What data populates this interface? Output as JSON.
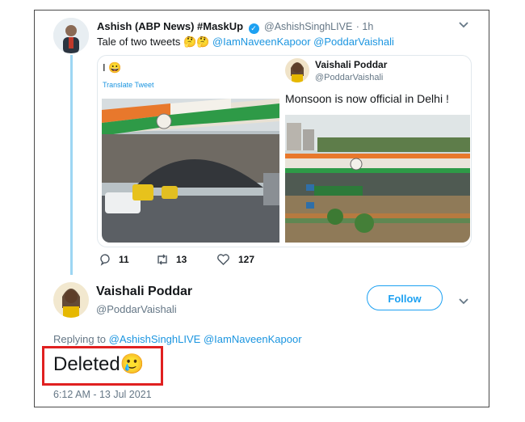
{
  "original_tweet": {
    "display_name": "Ashish (ABP News) #MaskUp",
    "handle": "@AshishSinghLIVE",
    "time": "· 1h",
    "text_prefix": "Tale of two tweets 🤔🤔",
    "mention_1": "@IamNaveenKapoor",
    "mention_2": "@PoddarVaishali",
    "left_embed": {
      "text": "I 😀",
      "translate_label": "Translate Tweet"
    },
    "right_embed": {
      "display_name": "Vaishali Poddar",
      "handle": "@PoddarVaishali",
      "text": "Monsoon is now official in Delhi !"
    },
    "actions": {
      "replies": "11",
      "retweets": "13",
      "likes": "127"
    }
  },
  "reply_tweet": {
    "display_name": "Vaishali Poddar",
    "handle": "@PoddarVaishali",
    "follow_label": "Follow",
    "replying_prefix": "Replying to",
    "replying_mention_1": "@AshishSinghLIVE",
    "replying_mention_2": "@IamNaveenKapoor",
    "text": "Deleted",
    "text_emoji": "🥲",
    "timestamp": "6:12 AM - 13 Jul 2021"
  },
  "colors": {
    "link": "#1b95e0",
    "highlight_box": "#e02020",
    "thread_line": "#9dd6f3"
  }
}
